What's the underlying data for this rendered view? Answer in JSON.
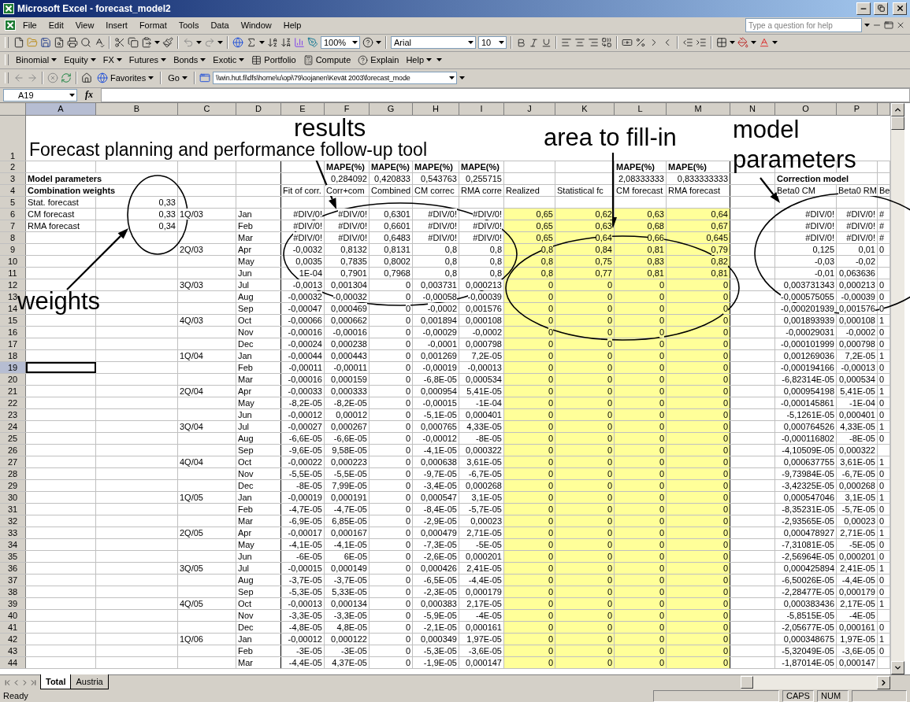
{
  "window": {
    "title": "Microsoft Excel - forecast_model2"
  },
  "menu": [
    "File",
    "Edit",
    "View",
    "Insert",
    "Format",
    "Tools",
    "Data",
    "Window",
    "Help"
  ],
  "help_box": {
    "placeholder": "Type a question for help"
  },
  "standard_toolbar": {
    "zoom": "100%",
    "font": "Arial",
    "font_size": "10"
  },
  "custom_toolbar": [
    {
      "label": "Binomial",
      "kind": "menu"
    },
    {
      "label": "Equity",
      "kind": "menu"
    },
    {
      "label": "FX",
      "kind": "menu"
    },
    {
      "label": "Futures",
      "kind": "menu"
    },
    {
      "label": "Bonds",
      "kind": "menu"
    },
    {
      "label": "Exotic",
      "kind": "menu"
    },
    {
      "label": "Portfolio",
      "kind": "portfolio"
    },
    {
      "label": "Compute",
      "kind": "compute"
    },
    {
      "label": "Explain",
      "kind": "explain"
    },
    {
      "label": "Help",
      "kind": "menu"
    }
  ],
  "web_toolbar": {
    "favorites": "Favorites",
    "go": "Go",
    "address": "\\\\win.hut.fi\\dfs\\home\\u\\opi\\79\\oojanen\\Kevät 2003\\forecast_mode"
  },
  "formula_bar": {
    "name_box": "A19",
    "function_label": "fx"
  },
  "columns": [
    {
      "letter": "A",
      "selected": true,
      "fill_in": false
    },
    {
      "letter": "B",
      "selected": false,
      "fill_in": false
    },
    {
      "letter": "C",
      "selected": false,
      "fill_in": false
    },
    {
      "letter": "D",
      "selected": false,
      "fill_in": false
    },
    {
      "letter": "E",
      "selected": false,
      "fill_in": false
    },
    {
      "letter": "F",
      "selected": false,
      "fill_in": false
    },
    {
      "letter": "G",
      "selected": false,
      "fill_in": false
    },
    {
      "letter": "H",
      "selected": false,
      "fill_in": false
    },
    {
      "letter": "I",
      "selected": false,
      "fill_in": false
    },
    {
      "letter": "J",
      "selected": false,
      "fill_in": true
    },
    {
      "letter": "K",
      "selected": false,
      "fill_in": true
    },
    {
      "letter": "L",
      "selected": false,
      "fill_in": true
    },
    {
      "letter": "M",
      "selected": false,
      "fill_in": true
    },
    {
      "letter": "N",
      "selected": false,
      "fill_in": false
    },
    {
      "letter": "O",
      "selected": false,
      "fill_in": false
    },
    {
      "letter": "P",
      "selected": false,
      "fill_in": false
    }
  ],
  "rows": [
    {
      "n": "1",
      "kind": "title",
      "selected": false,
      "fill_in": false,
      "cells": {
        "A": "Forecast planning and performance follow-up tool"
      }
    },
    {
      "n": "2",
      "kind": "data",
      "selected": false,
      "fill_in": false,
      "cells": {
        "F": {
          "text": "MAPE(%)",
          "bold": true
        },
        "G": {
          "text": "MAPE(%)",
          "bold": true
        },
        "H": {
          "text": "MAPE(%)",
          "bold": true
        },
        "I": {
          "text": "MAPE(%)",
          "bold": true
        },
        "L": {
          "text": "MAPE(%)",
          "bold": true
        },
        "M": {
          "text": "MAPE(%)",
          "bold": true
        }
      }
    },
    {
      "n": "3",
      "kind": "data",
      "selected": false,
      "fill_in": false,
      "cells": {
        "A": {
          "text": "Model parameters",
          "bold": true
        },
        "F": "0,284092",
        "G": "0,420833",
        "H": "0,543763",
        "I": "0,255715",
        "L": "2,08333333",
        "M": "0,833333333",
        "O": {
          "text": "Correction model",
          "bold": true
        }
      }
    },
    {
      "n": "4",
      "kind": "labels",
      "selected": false,
      "fill_in": false,
      "cells": {
        "A": {
          "text": "Combination weights",
          "bold": true
        },
        "E": "Fit of corr.",
        "F": "Corr+com",
        "G": "Combined",
        "H": "CM correc",
        "I": "RMA corre",
        "J": "Realized",
        "K": "Statistical fc",
        "L": "CM forecast",
        "M": "RMA forecast",
        "O": "Beta0 CM",
        "P": "Beta0 RM",
        "Q": "Be"
      }
    },
    {
      "n": "5",
      "kind": "data",
      "selected": false,
      "fill_in": false,
      "cells": {
        "A": "Stat. forecast",
        "B": "0,33"
      }
    },
    {
      "n": "6",
      "kind": "data",
      "selected": false,
      "fill_in": true,
      "cells": {
        "A": "CM forecast",
        "B": "0,33",
        "C": "1Q/03",
        "D": "Jan",
        "E": "#DIV/0!",
        "F": "#DIV/0!",
        "G": "0,6301",
        "H": "#DIV/0!",
        "I": "#DIV/0!",
        "J": "0,65",
        "K": "0,62",
        "L": "0,63",
        "M": "0,64",
        "O": "#DIV/0!",
        "P": "#DIV/0!",
        "Q": "#"
      }
    },
    {
      "n": "7",
      "kind": "data",
      "selected": false,
      "fill_in": true,
      "cells": {
        "A": "RMA forecast",
        "B": "0,34",
        "D": "Feb",
        "E": "#DIV/0!",
        "F": "#DIV/0!",
        "G": "0,6601",
        "H": "#DIV/0!",
        "I": "#DIV/0!",
        "J": "0,65",
        "K": "0,63",
        "L": "0,68",
        "M": "0,67",
        "O": "#DIV/0!",
        "P": "#DIV/0!",
        "Q": "#"
      }
    },
    {
      "n": "8",
      "kind": "data",
      "selected": false,
      "fill_in": true,
      "cells": {
        "D": "Mar",
        "E": "#DIV/0!",
        "F": "#DIV/0!",
        "G": "0,6483",
        "H": "#DIV/0!",
        "I": "#DIV/0!",
        "J": "0,65",
        "K": "0,64",
        "L": "0,66",
        "M": "0,645",
        "O": "#DIV/0!",
        "P": "#DIV/0!",
        "Q": "#"
      }
    },
    {
      "n": "9",
      "kind": "data",
      "selected": false,
      "fill_in": true,
      "cells": {
        "C": "2Q/03",
        "D": "Apr",
        "E": "-0,0032",
        "F": "0,8132",
        "G": "0,8131",
        "H": "0,8",
        "I": "0,8",
        "J": "0,8",
        "K": "0,84",
        "L": "0,81",
        "M": "0,79",
        "O": "0,125",
        "P": "0,01",
        "Q": "0"
      }
    },
    {
      "n": "10",
      "kind": "data",
      "selected": false,
      "fill_in": true,
      "cells": {
        "D": "May",
        "E": "0,0035",
        "F": "0,7835",
        "G": "0,8002",
        "H": "0,8",
        "I": "0,8",
        "J": "0,8",
        "K": "0,75",
        "L": "0,83",
        "M": "0,82",
        "O": "-0,03",
        "P": "-0,02"
      }
    },
    {
      "n": "11",
      "kind": "data",
      "selected": false,
      "fill_in": true,
      "cells": {
        "D": "Jun",
        "E": "1E-04",
        "F": "0,7901",
        "G": "0,7968",
        "H": "0,8",
        "I": "0,8",
        "J": "0,8",
        "K": "0,77",
        "L": "0,81",
        "M": "0,81",
        "O": "-0,01",
        "P": "0,063636"
      }
    },
    {
      "n": "12",
      "kind": "data",
      "selected": false,
      "fill_in": true,
      "cells": {
        "C": "3Q/03",
        "D": "Jul",
        "E": "-0,0013",
        "F": "0,001304",
        "G": "0",
        "H": "0,003731",
        "I": "0,000213",
        "J": "0",
        "K": "0",
        "L": "0",
        "M": "0",
        "O": "0,003731343",
        "P": "0,000213",
        "Q": "0"
      }
    },
    {
      "n": "13",
      "kind": "data",
      "selected": false,
      "fill_in": true,
      "cells": {
        "D": "Aug",
        "E": "-0,00032",
        "F": "-0,00032",
        "G": "0",
        "H": "-0,00058",
        "I": "-0,00039",
        "J": "0",
        "K": "0",
        "L": "0",
        "M": "0",
        "O": "-0,000575055",
        "P": "-0,00039",
        "Q": "0"
      }
    },
    {
      "n": "14",
      "kind": "data",
      "selected": false,
      "fill_in": true,
      "cells": {
        "D": "Sep",
        "E": "-0,00047",
        "F": "0,000469",
        "G": "0",
        "H": "-0,0002",
        "I": "0,001576",
        "J": "0",
        "K": "0",
        "L": "0",
        "M": "0",
        "O": "-0,000201939",
        "P": "0,001576",
        "Q": "0"
      }
    },
    {
      "n": "15",
      "kind": "data",
      "selected": false,
      "fill_in": true,
      "cells": {
        "C": "4Q/03",
        "D": "Oct",
        "E": "-0,00066",
        "F": "0,000662",
        "G": "0",
        "H": "0,001894",
        "I": "0,000108",
        "J": "0",
        "K": "0",
        "L": "0",
        "M": "0",
        "O": "0,001893939",
        "P": "0,000108",
        "Q": "1"
      }
    },
    {
      "n": "16",
      "kind": "data",
      "selected": false,
      "fill_in": true,
      "cells": {
        "D": "Nov",
        "E": "-0,00016",
        "F": "-0,00016",
        "G": "0",
        "H": "-0,00029",
        "I": "-0,0002",
        "J": "0",
        "K": "0",
        "L": "0",
        "M": "0",
        "O": "-0,00029031",
        "P": "-0,0002",
        "Q": "0"
      }
    },
    {
      "n": "17",
      "kind": "data",
      "selected": false,
      "fill_in": true,
      "cells": {
        "D": "Dec",
        "E": "-0,00024",
        "F": "0,000238",
        "G": "0",
        "H": "-0,0001",
        "I": "0,000798",
        "J": "0",
        "K": "0",
        "L": "0",
        "M": "0",
        "O": "-0,000101999",
        "P": "0,000798",
        "Q": "0"
      }
    },
    {
      "n": "18",
      "kind": "data",
      "selected": false,
      "fill_in": true,
      "cells": {
        "C": "1Q/04",
        "D": "Jan",
        "E": "-0,00044",
        "F": "0,000443",
        "G": "0",
        "H": "0,001269",
        "I": "7,2E-05",
        "J": "0",
        "K": "0",
        "L": "0",
        "M": "0",
        "O": "0,001269036",
        "P": "7,2E-05",
        "Q": "1"
      }
    },
    {
      "n": "19",
      "kind": "data",
      "selected": true,
      "fill_in": true,
      "cells": {
        "D": "Feb",
        "E": "-0,00011",
        "F": "-0,00011",
        "G": "0",
        "H": "-0,00019",
        "I": "-0,00013",
        "J": "0",
        "K": "0",
        "L": "0",
        "M": "0",
        "O": "-0,000194166",
        "P": "-0,00013",
        "Q": "0"
      }
    },
    {
      "n": "20",
      "kind": "data",
      "selected": false,
      "fill_in": true,
      "cells": {
        "D": "Mar",
        "E": "-0,00016",
        "F": "0,000159",
        "G": "0",
        "H": "-6,8E-05",
        "I": "0,000534",
        "J": "0",
        "K": "0",
        "L": "0",
        "M": "0",
        "O": "-6,82314E-05",
        "P": "0,000534",
        "Q": "0"
      }
    },
    {
      "n": "21",
      "kind": "data",
      "selected": false,
      "fill_in": true,
      "cells": {
        "C": "2Q/04",
        "D": "Apr",
        "E": "-0,00033",
        "F": "0,000333",
        "G": "0",
        "H": "0,000954",
        "I": "5,41E-05",
        "J": "0",
        "K": "0",
        "L": "0",
        "M": "0",
        "O": "0,000954198",
        "P": "5,41E-05",
        "Q": "1"
      }
    },
    {
      "n": "22",
      "kind": "data",
      "selected": false,
      "fill_in": true,
      "cells": {
        "D": "May",
        "E": "-8,2E-05",
        "F": "-8,2E-05",
        "G": "0",
        "H": "-0,00015",
        "I": "-1E-04",
        "J": "0",
        "K": "0",
        "L": "0",
        "M": "0",
        "O": "-0,000145861",
        "P": "-1E-04",
        "Q": "0"
      }
    },
    {
      "n": "23",
      "kind": "data",
      "selected": false,
      "fill_in": true,
      "cells": {
        "D": "Jun",
        "E": "-0,00012",
        "F": "0,00012",
        "G": "0",
        "H": "-5,1E-05",
        "I": "0,000401",
        "J": "0",
        "K": "0",
        "L": "0",
        "M": "0",
        "O": "-5,1261E-05",
        "P": "0,000401",
        "Q": "0"
      }
    },
    {
      "n": "24",
      "kind": "data",
      "selected": false,
      "fill_in": true,
      "cells": {
        "C": "3Q/04",
        "D": "Jul",
        "E": "-0,00027",
        "F": "0,000267",
        "G": "0",
        "H": "0,000765",
        "I": "4,33E-05",
        "J": "0",
        "K": "0",
        "L": "0",
        "M": "0",
        "O": "0,000764526",
        "P": "4,33E-05",
        "Q": "1"
      }
    },
    {
      "n": "25",
      "kind": "data",
      "selected": false,
      "fill_in": true,
      "cells": {
        "D": "Aug",
        "E": "-6,6E-05",
        "F": "-6,6E-05",
        "G": "0",
        "H": "-0,00012",
        "I": "-8E-05",
        "J": "0",
        "K": "0",
        "L": "0",
        "M": "0",
        "O": "-0,000116802",
        "P": "-8E-05",
        "Q": "0"
      }
    },
    {
      "n": "26",
      "kind": "data",
      "selected": false,
      "fill_in": true,
      "cells": {
        "D": "Sep",
        "E": "-9,6E-05",
        "F": "9,58E-05",
        "G": "0",
        "H": "-4,1E-05",
        "I": "0,000322",
        "J": "0",
        "K": "0",
        "L": "0",
        "M": "0",
        "O": "-4,10509E-05",
        "P": "0,000322"
      }
    },
    {
      "n": "27",
      "kind": "data",
      "selected": false,
      "fill_in": true,
      "cells": {
        "C": "4Q/04",
        "D": "Oct",
        "E": "-0,00022",
        "F": "0,000223",
        "G": "0",
        "H": "0,000638",
        "I": "3,61E-05",
        "J": "0",
        "K": "0",
        "L": "0",
        "M": "0",
        "O": "0,000637755",
        "P": "3,61E-05",
        "Q": "1"
      }
    },
    {
      "n": "28",
      "kind": "data",
      "selected": false,
      "fill_in": true,
      "cells": {
        "D": "Nov",
        "E": "-5,5E-05",
        "F": "-5,5E-05",
        "G": "0",
        "H": "-9,7E-05",
        "I": "-6,7E-05",
        "J": "0",
        "K": "0",
        "L": "0",
        "M": "0",
        "O": "-9,73984E-05",
        "P": "-6,7E-05",
        "Q": "0"
      }
    },
    {
      "n": "29",
      "kind": "data",
      "selected": false,
      "fill_in": true,
      "cells": {
        "D": "Dec",
        "E": "-8E-05",
        "F": "7,99E-05",
        "G": "0",
        "H": "-3,4E-05",
        "I": "0,000268",
        "J": "0",
        "K": "0",
        "L": "0",
        "M": "0",
        "O": "-3,42325E-05",
        "P": "0,000268",
        "Q": "0"
      }
    },
    {
      "n": "30",
      "kind": "data",
      "selected": false,
      "fill_in": true,
      "cells": {
        "C": "1Q/05",
        "D": "Jan",
        "E": "-0,00019",
        "F": "0,000191",
        "G": "0",
        "H": "0,000547",
        "I": "3,1E-05",
        "J": "0",
        "K": "0",
        "L": "0",
        "M": "0",
        "O": "0,000547046",
        "P": "3,1E-05",
        "Q": "1"
      }
    },
    {
      "n": "31",
      "kind": "data",
      "selected": false,
      "fill_in": true,
      "cells": {
        "D": "Feb",
        "E": "-4,7E-05",
        "F": "-4,7E-05",
        "G": "0",
        "H": "-8,4E-05",
        "I": "-5,7E-05",
        "J": "0",
        "K": "0",
        "L": "0",
        "M": "0",
        "O": "-8,35231E-05",
        "P": "-5,7E-05",
        "Q": "0"
      }
    },
    {
      "n": "32",
      "kind": "data",
      "selected": false,
      "fill_in": true,
      "cells": {
        "D": "Mar",
        "E": "-6,9E-05",
        "F": "6,85E-05",
        "G": "0",
        "H": "-2,9E-05",
        "I": "0,00023",
        "J": "0",
        "K": "0",
        "L": "0",
        "M": "0",
        "O": "-2,93565E-05",
        "P": "0,00023",
        "Q": "0"
      }
    },
    {
      "n": "33",
      "kind": "data",
      "selected": false,
      "fill_in": true,
      "cells": {
        "C": "2Q/05",
        "D": "Apr",
        "E": "-0,00017",
        "F": "0,000167",
        "G": "0",
        "H": "0,000479",
        "I": "2,71E-05",
        "J": "0",
        "K": "0",
        "L": "0",
        "M": "0",
        "O": "0,000478927",
        "P": "2,71E-05",
        "Q": "1"
      }
    },
    {
      "n": "34",
      "kind": "data",
      "selected": false,
      "fill_in": true,
      "cells": {
        "D": "May",
        "E": "-4,1E-05",
        "F": "-4,1E-05",
        "G": "0",
        "H": "-7,3E-05",
        "I": "-5E-05",
        "J": "0",
        "K": "0",
        "L": "0",
        "M": "0",
        "O": "-7,31081E-05",
        "P": "-5E-05",
        "Q": "0"
      }
    },
    {
      "n": "35",
      "kind": "data",
      "selected": false,
      "fill_in": true,
      "cells": {
        "D": "Jun",
        "E": "-6E-05",
        "F": "6E-05",
        "G": "0",
        "H": "-2,6E-05",
        "I": "0,000201",
        "J": "0",
        "K": "0",
        "L": "0",
        "M": "0",
        "O": "-2,56964E-05",
        "P": "0,000201",
        "Q": "0"
      }
    },
    {
      "n": "36",
      "kind": "data",
      "selected": false,
      "fill_in": true,
      "cells": {
        "C": "3Q/05",
        "D": "Jul",
        "E": "-0,00015",
        "F": "0,000149",
        "G": "0",
        "H": "0,000426",
        "I": "2,41E-05",
        "J": "0",
        "K": "0",
        "L": "0",
        "M": "0",
        "O": "0,000425894",
        "P": "2,41E-05",
        "Q": "1"
      }
    },
    {
      "n": "37",
      "kind": "data",
      "selected": false,
      "fill_in": true,
      "cells": {
        "D": "Aug",
        "E": "-3,7E-05",
        "F": "-3,7E-05",
        "G": "0",
        "H": "-6,5E-05",
        "I": "-4,4E-05",
        "J": "0",
        "K": "0",
        "L": "0",
        "M": "0",
        "O": "-6,50026E-05",
        "P": "-4,4E-05",
        "Q": "0"
      }
    },
    {
      "n": "38",
      "kind": "data",
      "selected": false,
      "fill_in": true,
      "cells": {
        "D": "Sep",
        "E": "-5,3E-05",
        "F": "5,33E-05",
        "G": "0",
        "H": "-2,3E-05",
        "I": "0,000179",
        "J": "0",
        "K": "0",
        "L": "0",
        "M": "0",
        "O": "-2,28477E-05",
        "P": "0,000179",
        "Q": "0"
      }
    },
    {
      "n": "39",
      "kind": "data",
      "selected": false,
      "fill_in": true,
      "cells": {
        "C": "4Q/05",
        "D": "Oct",
        "E": "-0,00013",
        "F": "0,000134",
        "G": "0",
        "H": "0,000383",
        "I": "2,17E-05",
        "J": "0",
        "K": "0",
        "L": "0",
        "M": "0",
        "O": "0,000383436",
        "P": "2,17E-05",
        "Q": "1"
      }
    },
    {
      "n": "40",
      "kind": "data",
      "selected": false,
      "fill_in": true,
      "cells": {
        "D": "Nov",
        "E": "-3,3E-05",
        "F": "-3,3E-05",
        "G": "0",
        "H": "-5,9E-05",
        "I": "-4E-05",
        "J": "0",
        "K": "0",
        "L": "0",
        "M": "0",
        "O": "-5,8515E-05",
        "P": "-4E-05"
      }
    },
    {
      "n": "41",
      "kind": "data",
      "selected": false,
      "fill_in": true,
      "cells": {
        "D": "Dec",
        "E": "-4,8E-05",
        "F": "4,8E-05",
        "G": "0",
        "H": "-2,1E-05",
        "I": "0,000161",
        "J": "0",
        "K": "0",
        "L": "0",
        "M": "0",
        "O": "-2,05677E-05",
        "P": "0,000161",
        "Q": "0"
      }
    },
    {
      "n": "42",
      "kind": "data",
      "selected": false,
      "fill_in": true,
      "cells": {
        "C": "1Q/06",
        "D": "Jan",
        "E": "-0,00012",
        "F": "0,000122",
        "G": "0",
        "H": "0,000349",
        "I": "1,97E-05",
        "J": "0",
        "K": "0",
        "L": "0",
        "M": "0",
        "O": "0,000348675",
        "P": "1,97E-05",
        "Q": "1"
      }
    },
    {
      "n": "43",
      "kind": "data",
      "selected": false,
      "fill_in": true,
      "cells": {
        "D": "Feb",
        "E": "-3E-05",
        "F": "-3E-05",
        "G": "0",
        "H": "-5,3E-05",
        "I": "-3,6E-05",
        "J": "0",
        "K": "0",
        "L": "0",
        "M": "0",
        "O": "-5,32049E-05",
        "P": "-3,6E-05",
        "Q": "0"
      }
    },
    {
      "n": "44",
      "kind": "data",
      "selected": false,
      "fill_in": true,
      "cells": {
        "D": "Mar",
        "E": "-4,4E-05",
        "F": "4,37E-05",
        "G": "0",
        "H": "-1,9E-05",
        "I": "0,000147",
        "J": "0",
        "K": "0",
        "L": "0",
        "M": "0",
        "O": "-1,87014E-05",
        "P": "0,000147"
      }
    }
  ],
  "annotations": [
    {
      "text": "results"
    },
    {
      "text": "area to fill-in"
    },
    {
      "text": "model parameters"
    },
    {
      "text": "weights"
    }
  ],
  "sheet_tabs": [
    {
      "label": "Total",
      "selected": true
    },
    {
      "label": "Austria",
      "selected": false
    }
  ],
  "status_bar": {
    "text": "Ready",
    "indicators": [
      "CAPS",
      "NUM"
    ]
  }
}
